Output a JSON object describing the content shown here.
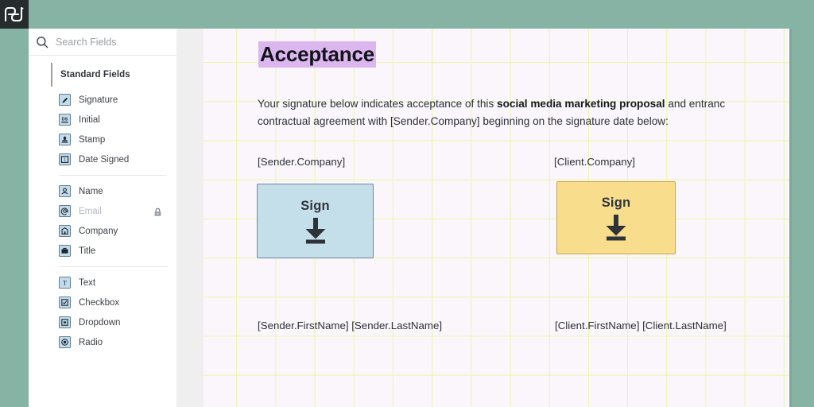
{
  "brand": {
    "logo_name": "pandadoc-logo",
    "logo_text": "pd",
    "trademark": "®",
    "accent_green": "#87b3a5",
    "logo_bg": "#262b2e"
  },
  "rail": {
    "items": [
      {
        "name": "content-library-icon",
        "icon": "rectangle-outline-icon"
      },
      {
        "name": "fields-tool-icon",
        "icon": "signature-tool-icon"
      }
    ]
  },
  "sidebar": {
    "search": {
      "placeholder": "Search Fields",
      "value": "",
      "search_icon": "search-icon",
      "close_icon": "close-icon"
    },
    "section_title": "Standard Fields",
    "groups": [
      {
        "items": [
          {
            "label": "Signature",
            "icon": "pen-icon",
            "locked": false
          },
          {
            "label": "Initial",
            "icon": "ds-initials-icon",
            "locked": false
          },
          {
            "label": "Stamp",
            "icon": "stamp-icon",
            "locked": false
          },
          {
            "label": "Date Signed",
            "icon": "calendar-icon",
            "locked": false
          }
        ]
      },
      {
        "items": [
          {
            "label": "Name",
            "icon": "person-icon",
            "locked": false
          },
          {
            "label": "Email",
            "icon": "at-sign-icon",
            "locked": true
          },
          {
            "label": "Company",
            "icon": "building-icon",
            "locked": false
          },
          {
            "label": "Title",
            "icon": "briefcase-icon",
            "locked": false
          }
        ]
      },
      {
        "items": [
          {
            "label": "Text",
            "icon": "text-t-icon",
            "locked": false
          },
          {
            "label": "Checkbox",
            "icon": "checkbox-icon",
            "locked": false
          },
          {
            "label": "Dropdown",
            "icon": "dropdown-icon",
            "locked": false
          },
          {
            "label": "Radio",
            "icon": "radio-icon",
            "locked": false
          }
        ]
      }
    ]
  },
  "document": {
    "title": "Acceptance",
    "title_highlight_color": "#dcb6ef",
    "paragraph": {
      "line1_pre": "Your signature below indicates acceptance of this ",
      "line1_bold": "social media marketing proposal",
      "line1_post": " and entranc",
      "line2": "contractual agreement with [Sender.Company] beginning on the signature date below:"
    },
    "sender_company_label": "[Sender.Company]",
    "client_company_label": "[Client.Company]",
    "sender_signature_field": {
      "label": "Sign",
      "icon": "download-arrow-icon",
      "fill": "#c5dfea",
      "border": "#6d87a4"
    },
    "client_signature_field": {
      "label": "Sign",
      "icon": "download-arrow-icon",
      "fill": "#f8dd8d",
      "border": "#c9a64e"
    },
    "sender_name_line": "[Sender.FirstName] [Sender.LastName]",
    "client_name_line": "[Client.FirstName] [Client.LastName]"
  }
}
